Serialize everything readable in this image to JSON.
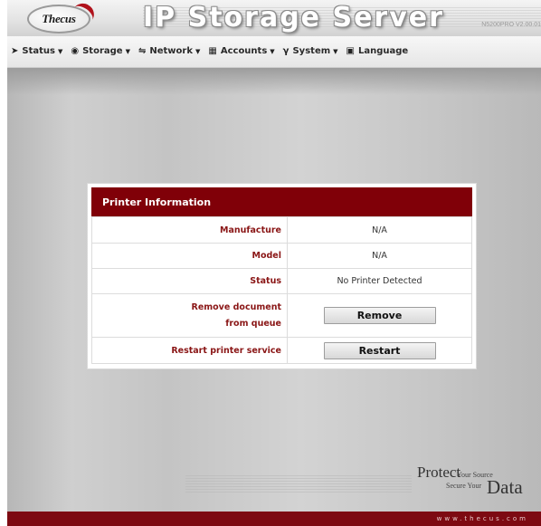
{
  "header": {
    "logo_text": "Thecus",
    "title": "IP Storage Server",
    "version": "N5200PRO V2.00.01"
  },
  "nav": {
    "items": [
      {
        "label": "Status",
        "icon": "arrow-icon",
        "has_caret": true
      },
      {
        "label": "Storage",
        "icon": "disk-icon",
        "has_caret": true
      },
      {
        "label": "Network",
        "icon": "network-icon",
        "has_caret": true
      },
      {
        "label": "Accounts",
        "icon": "accounts-icon",
        "has_caret": true
      },
      {
        "label": "System",
        "icon": "system-icon",
        "has_caret": true
      },
      {
        "label": "Language",
        "icon": "language-icon",
        "has_caret": false
      }
    ]
  },
  "panel": {
    "title": "Printer Information",
    "rows": {
      "manufacture": {
        "label": "Manufacture",
        "value": "N/A"
      },
      "model": {
        "label": "Model",
        "value": "N/A"
      },
      "status": {
        "label": "Status",
        "value": "No Printer Detected"
      },
      "remove": {
        "label_line1": "Remove document",
        "label_line2": "from queue",
        "button": "Remove"
      },
      "restart": {
        "label": "Restart printer service",
        "button": "Restart"
      }
    }
  },
  "slogan": {
    "protect": "Protect",
    "your_source": "Your Source",
    "secure_your": "Secure Your",
    "data": "Data"
  },
  "footer": {
    "url": "www.thecus.com"
  },
  "colors": {
    "panel_header": "#800008",
    "label_text": "#8a1616",
    "footer_bar": "#7d0a12"
  }
}
